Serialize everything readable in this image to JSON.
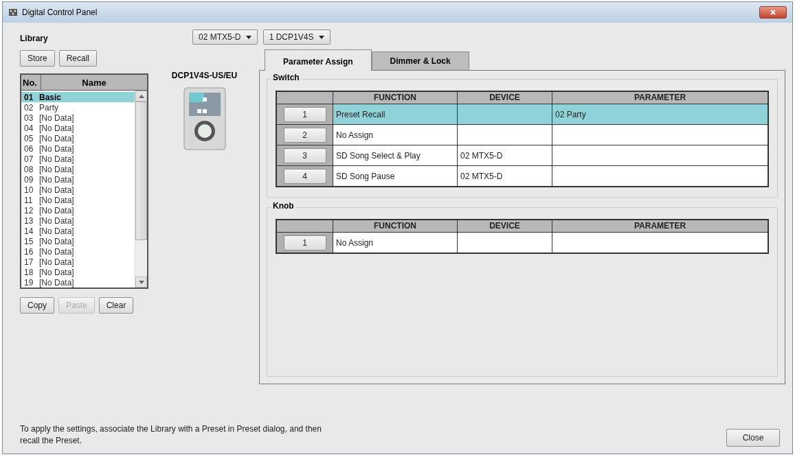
{
  "window": {
    "title": "Digital Control Panel"
  },
  "library": {
    "label": "Library",
    "buttons": [
      {
        "label": "Store",
        "disabled": false
      },
      {
        "label": "Recall",
        "disabled": false
      }
    ],
    "columns": [
      "No.",
      "Name"
    ],
    "items": [
      {
        "no": "01",
        "name": "Basic",
        "selected": true
      },
      {
        "no": "02",
        "name": "Party",
        "selected": false
      },
      {
        "no": "03",
        "name": "[No Data]",
        "selected": false
      },
      {
        "no": "04",
        "name": "[No Data]",
        "selected": false
      },
      {
        "no": "05",
        "name": "[No Data]",
        "selected": false
      },
      {
        "no": "06",
        "name": "[No Data]",
        "selected": false
      },
      {
        "no": "07",
        "name": "[No Data]",
        "selected": false
      },
      {
        "no": "08",
        "name": "[No Data]",
        "selected": false
      },
      {
        "no": "09",
        "name": "[No Data]",
        "selected": false
      },
      {
        "no": "10",
        "name": "[No Data]",
        "selected": false
      },
      {
        "no": "11",
        "name": "[No Data]",
        "selected": false
      },
      {
        "no": "12",
        "name": "[No Data]",
        "selected": false
      },
      {
        "no": "13",
        "name": "[No Data]",
        "selected": false
      },
      {
        "no": "14",
        "name": "[No Data]",
        "selected": false
      },
      {
        "no": "15",
        "name": "[No Data]",
        "selected": false
      },
      {
        "no": "16",
        "name": "[No Data]",
        "selected": false
      },
      {
        "no": "17",
        "name": "[No Data]",
        "selected": false
      },
      {
        "no": "18",
        "name": "[No Data]",
        "selected": false
      },
      {
        "no": "19",
        "name": "[No Data]",
        "selected": false
      }
    ],
    "edit_buttons": [
      {
        "label": "Copy",
        "disabled": false
      },
      {
        "label": "Paste",
        "disabled": true
      },
      {
        "label": "Clear",
        "disabled": false
      }
    ]
  },
  "selectors": [
    "02 MTX5-D",
    "1 DCP1V4S"
  ],
  "device": {
    "model": "DCP1V4S-US/EU"
  },
  "tabs": [
    {
      "label": "Parameter Assign",
      "selected": true
    },
    {
      "label": "Dimmer & Lock",
      "selected": false
    }
  ],
  "groups": [
    {
      "title": "Switch",
      "columns": [
        "FUNCTION",
        "DEVICE",
        "PARAMETER"
      ],
      "rows": [
        {
          "button": "1",
          "function": "Preset Recall",
          "device": "",
          "parameter": "02 Party",
          "selected": true
        },
        {
          "button": "2",
          "function": "No Assign",
          "device": "",
          "parameter": "",
          "selected": false
        },
        {
          "button": "3",
          "function": "SD Song Select & Play",
          "device": "02 MTX5-D",
          "parameter": "",
          "selected": false
        },
        {
          "button": "4",
          "function": "SD Song Pause",
          "device": "02 MTX5-D",
          "parameter": "",
          "selected": false
        }
      ]
    },
    {
      "title": "Knob",
      "columns": [
        "FUNCTION",
        "DEVICE",
        "PARAMETER"
      ],
      "rows": [
        {
          "button": "1",
          "function": "No Assign",
          "device": "",
          "parameter": "",
          "selected": false
        }
      ]
    }
  ],
  "footer": {
    "note": "To apply the settings, associate the Library with a Preset in Preset dialog, and then recall the Preset.",
    "close": "Close"
  }
}
